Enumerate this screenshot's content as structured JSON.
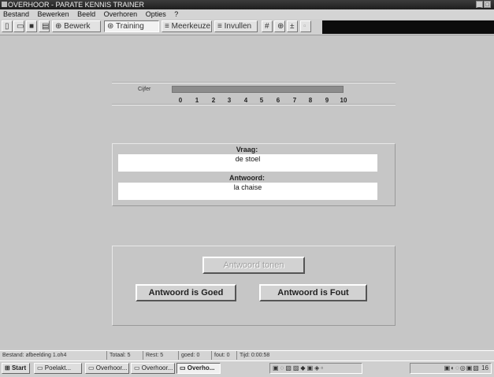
{
  "window": {
    "title": "OVERHOOR - PARATE KENNIS TRAINER"
  },
  "menu": [
    "Bestand",
    "Bewerken",
    "Beeld",
    "Overhoren",
    "Opties",
    "?"
  ],
  "toolbar": {
    "bewerk": "Bewerk",
    "training": "Training",
    "meerkeuze": "Meerkeuze",
    "invullen": "Invullen"
  },
  "cijfer": {
    "label": "Cijfer",
    "ticks": [
      "0",
      "1",
      "2",
      "3",
      "4",
      "5",
      "6",
      "7",
      "8",
      "9",
      "10"
    ]
  },
  "vraag": {
    "label": "Vraag:",
    "value": "de stoel"
  },
  "antwoord": {
    "label": "Antwoord:",
    "value": "la chaise"
  },
  "buttons": {
    "show_answer": "Antwoord tonen",
    "correct": "Antwoord is Goed",
    "wrong": "Antwoord is Fout"
  },
  "status": {
    "file": "Bestand: afbeelding 1.oh4",
    "totaal": "Totaal: 5",
    "rest": "Rest: 5",
    "goed": "goed: 0",
    "fout": "fout: 0",
    "tijd": "Tijd: 0:00:58"
  },
  "taskbar": {
    "start": "Start",
    "tasks": [
      "Poelakt...",
      "Overhoor...",
      "Overhoor...",
      "Overho..."
    ],
    "tray_left": "",
    "clock": "16"
  }
}
